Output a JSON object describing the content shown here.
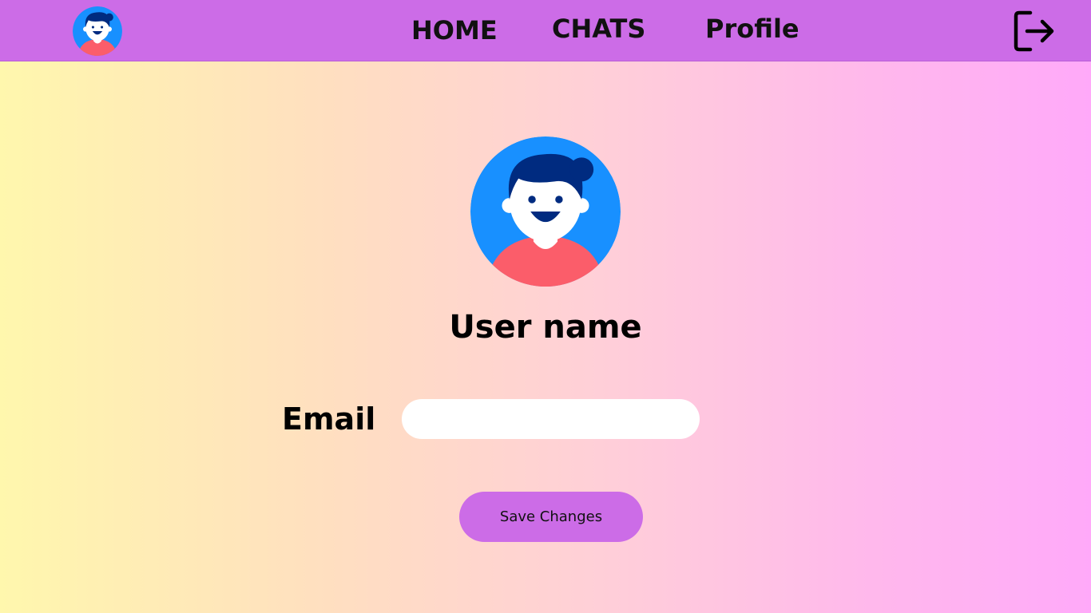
{
  "nav": {
    "avatar_icon": "user-avatar-icon",
    "links": [
      {
        "label": "HOME"
      },
      {
        "label": "CHATS"
      },
      {
        "label": "Profile"
      }
    ],
    "logout_icon": "logout-icon"
  },
  "profile": {
    "avatar_icon": "user-avatar-icon",
    "username": "User name",
    "email_label": "Email",
    "email_value": "",
    "save_label": "Save Changes"
  },
  "colors": {
    "nav_bg": "#cc6ce7",
    "button_bg": "#cc6ce7",
    "avatar_bg": "#1890ff",
    "avatar_hair": "#002b80",
    "avatar_shirt": "#fb5d6a",
    "gradient_start": "#fff7ad",
    "gradient_end": "#ffa9f9"
  }
}
